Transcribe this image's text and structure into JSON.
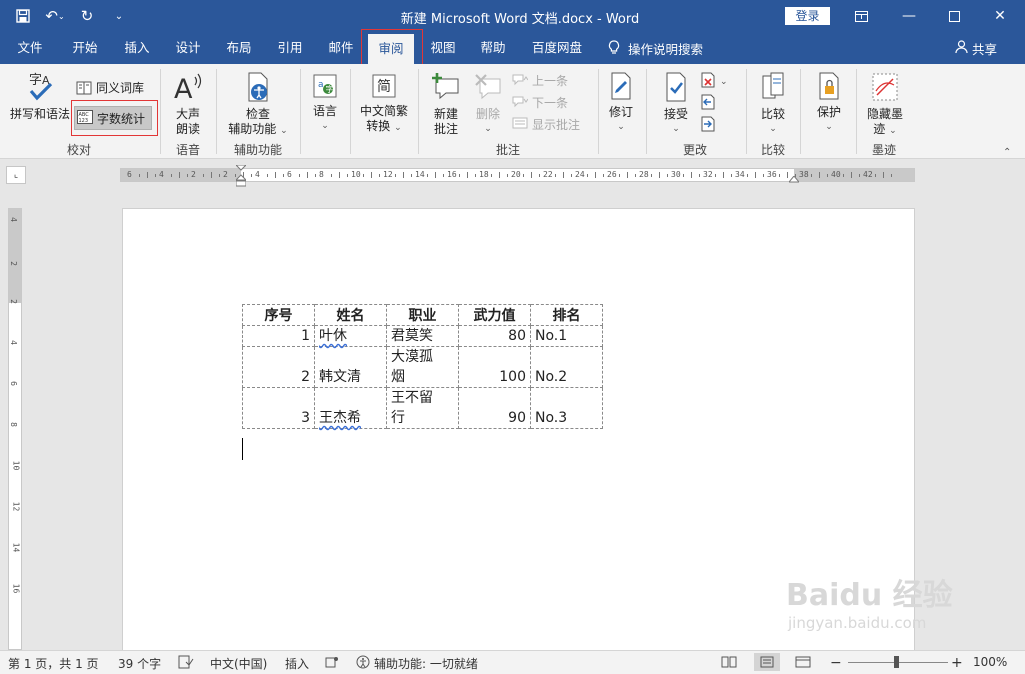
{
  "app": {
    "title": "新建 Microsoft Word 文档.docx  -  Word",
    "login": "登录",
    "share": "共享",
    "search_hint": "操作说明搜索"
  },
  "tabs": [
    "文件",
    "开始",
    "插入",
    "设计",
    "布局",
    "引用",
    "邮件",
    "审阅",
    "视图",
    "帮助",
    "百度网盘"
  ],
  "active_tab": "审阅",
  "ribbon": {
    "proofing": {
      "label": "校对",
      "spelling": "拼写和语法",
      "thesaurus": "同义词库",
      "word_count": "字数统计"
    },
    "speech": {
      "label": "语音",
      "read_aloud_1": "大声",
      "read_aloud_2": "朗读"
    },
    "accessibility": {
      "label": "辅助功能",
      "check_1": "检查",
      "check_2": "辅助功能"
    },
    "language": {
      "label": "语言"
    },
    "chinese": {
      "label_1": "中文简繁",
      "label_2": "转换",
      "icon_char": "简"
    },
    "comments": {
      "label": "批注",
      "new_1": "新建",
      "new_2": "批注",
      "delete": "删除",
      "prev": "上一条",
      "next": "下一条",
      "show": "显示批注"
    },
    "tracking": {
      "label": "修订"
    },
    "changes": {
      "label": "更改",
      "accept": "接受"
    },
    "compare": {
      "label": "比较",
      "button": "比较"
    },
    "protect": {
      "button": "保护"
    },
    "ink": {
      "label": "墨迹",
      "hide_1": "隐藏墨",
      "hide_2": "迹"
    }
  },
  "ruler": {
    "h_labels": [
      "6",
      "4",
      "2",
      "2",
      "4",
      "6",
      "8",
      "10",
      "12",
      "14",
      "16",
      "18",
      "20",
      "22",
      "24",
      "26",
      "28",
      "30",
      "32",
      "34",
      "36",
      "38",
      "40",
      "42"
    ],
    "v_labels": [
      "4",
      "2",
      "2",
      "4",
      "6",
      "8",
      "10",
      "12",
      "14",
      "16"
    ]
  },
  "document": {
    "headers": [
      "序号",
      "姓名",
      "职业",
      "武力值",
      "排名"
    ],
    "rows": [
      {
        "no": "1",
        "name": "叶休",
        "job": "君莫笑",
        "power": "80",
        "rank": "No.1"
      },
      {
        "no": "2",
        "name": "韩文清",
        "job_1": "大漠孤",
        "job_2": "烟",
        "power": "100",
        "rank": "No.2"
      },
      {
        "no": "3",
        "name": "王杰希",
        "job_1": "王不留",
        "job_2": "行",
        "power": "90",
        "rank": "No.3"
      }
    ]
  },
  "watermark": {
    "main": "Baidu 经验",
    "sub": "jingyan.baidu.com"
  },
  "status": {
    "page": "第 1 页，共 1 页",
    "words": "39 个字",
    "lang": "中文(中国)",
    "mode": "插入",
    "access": "辅助功能: 一切就绪",
    "zoom": "100%"
  },
  "colors": {
    "accent": "#2b579a",
    "highlight_box": "#e23636"
  }
}
